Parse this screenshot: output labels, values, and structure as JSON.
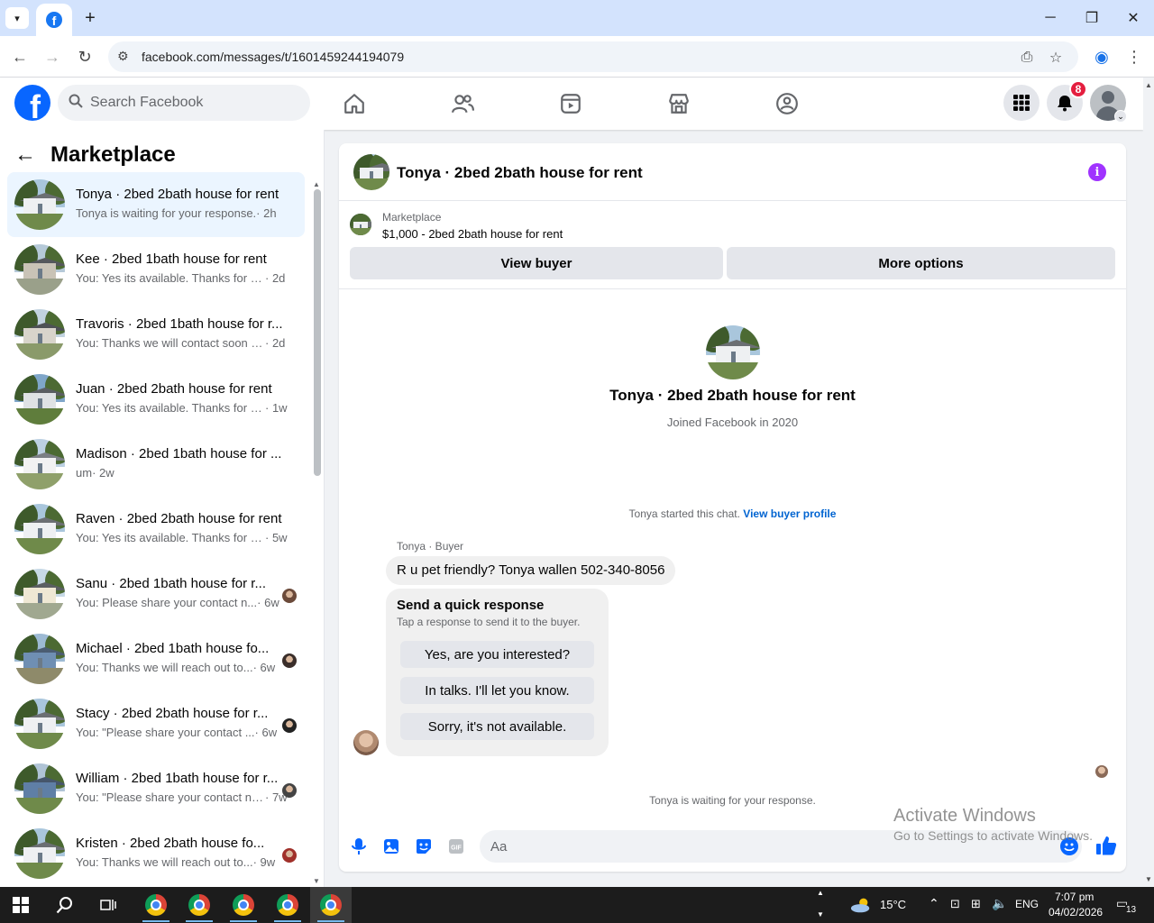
{
  "browser": {
    "url": "facebook.com/messages/t/1601459244194079"
  },
  "fb": {
    "search_placeholder": "Search Facebook",
    "notification_count": "8"
  },
  "left": {
    "title": "Marketplace",
    "conversations": [
      {
        "name": "Tonya · 2bed 2bath house for rent",
        "snippet": "Tonya is waiting for your response.",
        "time": "· 2h",
        "active": true
      },
      {
        "name": "Kee · 2bed 1bath house for rent",
        "snippet": "You: Yes its available. Thanks for rea...",
        "time": "· 2d"
      },
      {
        "name": "Travoris · 2bed 1bath house for r...",
        "snippet": "You: Thanks we will contact soon w...",
        "time": "· 2d"
      },
      {
        "name": "Juan · 2bed 2bath house for rent",
        "snippet": "You: Yes its available. Thanks for re...",
        "time": "· 1w"
      },
      {
        "name": "Madison · 2bed 1bath house for ...",
        "snippet": "um",
        "time": "· 2w"
      },
      {
        "name": "Raven · 2bed 2bath house for rent",
        "snippet": "You: Yes its available. Thanks for re...",
        "time": "· 5w"
      },
      {
        "name": "Sanu · 2bed 1bath house for r...",
        "snippet": "You: Please share your contact n...",
        "time": "· 6w"
      },
      {
        "name": "Michael · 2bed 1bath house fo...",
        "snippet": "You: Thanks we will reach out to...",
        "time": "· 6w"
      },
      {
        "name": "Stacy · 2bed 2bath house for r...",
        "snippet": "You: \"Please share your contact ...",
        "time": "· 6w"
      },
      {
        "name": "William · 2bed 1bath house for r...",
        "snippet": "You: \"Please share your contact nu...",
        "time": "· 7w"
      },
      {
        "name": "Kristen · 2bed 2bath house fo...",
        "snippet": "You: Thanks we will reach out to...",
        "time": "· 9w"
      }
    ]
  },
  "chat": {
    "title": "Tonya · 2bed 2bath house for rent",
    "marketplace_label": "Marketplace",
    "listing": "$1,000 - 2bed 2bath house for rent",
    "view_buyer": "View buyer",
    "more_options": "More options",
    "intro_name": "Tonya · 2bed 2bath house for rent",
    "intro_joined": "Joined Facebook in 2020",
    "started_text": "Tonya started this chat.",
    "view_buyer_profile": "View buyer profile",
    "sender_label": "Tonya · Buyer",
    "message": "R u pet friendly? Tonya wallen 502-340-8056",
    "quick_title": "Send a quick response",
    "quick_sub": "Tap a response to send it to the buyer.",
    "quick_replies": [
      "Yes, are you interested?",
      "In talks. I'll let you know.",
      "Sorry, it's not available."
    ],
    "waiting": "Tonya is waiting for your response.",
    "composer_placeholder": "Aa"
  },
  "watermark": {
    "line1": "Activate Windows",
    "line2": "Go to Settings to activate Windows."
  },
  "taskbar": {
    "temperature": "15°C",
    "language": "ENG",
    "time": "7:07 pm",
    "date": "04/02/2026",
    "notifications": "13"
  },
  "colors": {
    "fb_blue": "#0866ff",
    "info_purple": "#a033ff",
    "badge_red": "#e41e3f",
    "active_row": "#ebf5ff"
  }
}
